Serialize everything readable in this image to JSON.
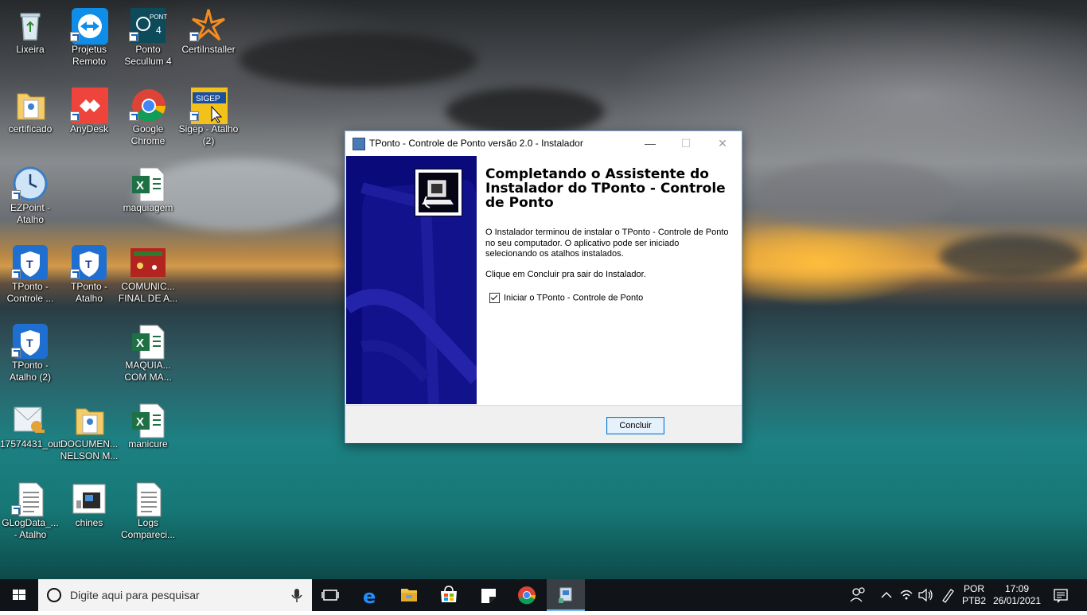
{
  "desktop": {
    "icons": [
      {
        "label": "Lixeira",
        "icon": "recycle-bin-icon"
      },
      {
        "label": "Projetus Remoto",
        "icon": "teamviewer-icon"
      },
      {
        "label": "Ponto Secullum 4",
        "icon": "ponto-secullum-icon"
      },
      {
        "label": "CertiInstaller",
        "icon": "certiinstaller-icon"
      },
      {
        "label": "certificado",
        "icon": "folder-icon"
      },
      {
        "label": "AnyDesk",
        "icon": "anydesk-icon"
      },
      {
        "label": "Google Chrome",
        "icon": "chrome-icon"
      },
      {
        "label": "Sigep - Atalho (2)",
        "icon": "sigep-icon"
      },
      {
        "label": "EZPoint - Atalho",
        "icon": "clock-icon"
      },
      {
        "label": "maquiagem",
        "icon": "excel-icon"
      },
      {
        "label": "TPonto - Controle ...",
        "icon": "tponto-icon"
      },
      {
        "label": "TPonto - Atalho",
        "icon": "tponto-icon"
      },
      {
        "label": "COMUNIC... FINAL DE A...",
        "icon": "image-file-icon"
      },
      {
        "label": "TPonto - Atalho (2)",
        "icon": "tponto-icon"
      },
      {
        "label": "MAQUIA... COM MA...",
        "icon": "excel-icon"
      },
      {
        "label": "17574431_out",
        "icon": "certificate-file-icon"
      },
      {
        "label": "DOCUMEN... NELSON M...",
        "icon": "folder-icon"
      },
      {
        "label": "manicure",
        "icon": "excel-icon"
      },
      {
        "label": "GLogData_... - Atalho",
        "icon": "text-file-icon"
      },
      {
        "label": "chines",
        "icon": "device-image-icon"
      },
      {
        "label": "Logs Compareci...",
        "icon": "text-file-icon"
      }
    ]
  },
  "installer": {
    "title": "TPonto - Controle de Ponto versão 2.0 - Instalador",
    "minimize_symbol": "—",
    "maximize_symbol": "☐",
    "close_symbol": "✕",
    "heading": "Completando o Assistente do Instalador do TPonto - Controle de Ponto",
    "paragraph": "O Instalador terminou de instalar o TPonto - Controle de Ponto no seu computador. O aplicativo pode ser iniciado selecionando os atalhos instalados.",
    "paragraph2": "Clique em Concluir pra sair do Instalador.",
    "checkbox_label": "Iniciar o TPonto - Controle de Ponto",
    "checkbox_checked": true,
    "finish_button": "Concluir"
  },
  "taskbar": {
    "search_placeholder": "Digite aqui para pesquisar",
    "apps": [
      "task-view-icon",
      "edge-icon",
      "file-explorer-icon",
      "store-icon",
      "sticky-notes-icon",
      "chrome-icon",
      "installer-icon"
    ],
    "language": "POR",
    "layout": "PTB2",
    "time": "17:09",
    "date": "26/01/2021"
  }
}
